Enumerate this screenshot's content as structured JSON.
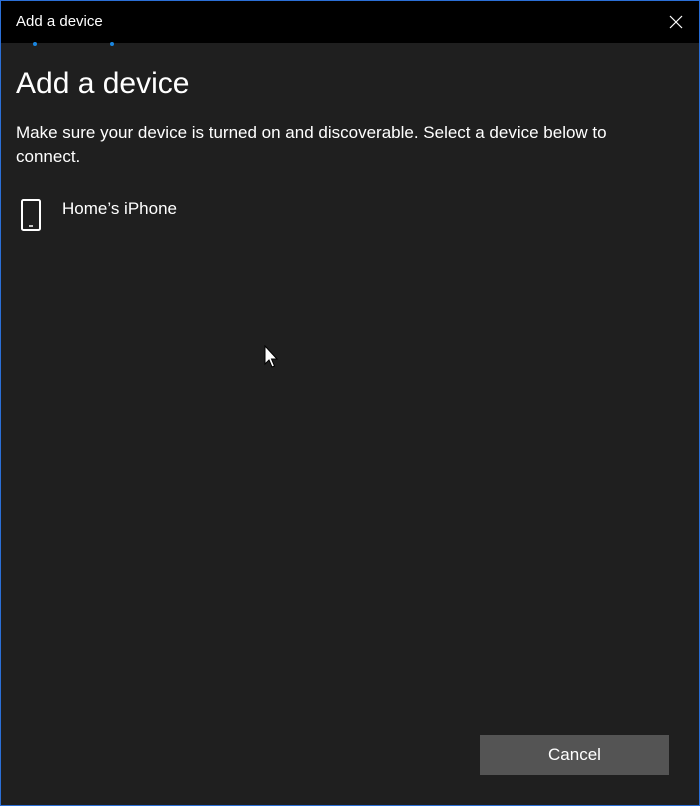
{
  "window": {
    "title": "Add a device"
  },
  "page": {
    "heading": "Add a device",
    "instructions": "Make sure your device is turned on and discoverable. Select a device below to connect."
  },
  "devices": [
    {
      "name": "Home’s iPhone",
      "icon": "phone-icon"
    }
  ],
  "actions": {
    "cancel_label": "Cancel"
  },
  "colors": {
    "accent": "#1a86e0",
    "background": "#1f1f1f",
    "titlebar": "#000000",
    "button": "#545454"
  }
}
